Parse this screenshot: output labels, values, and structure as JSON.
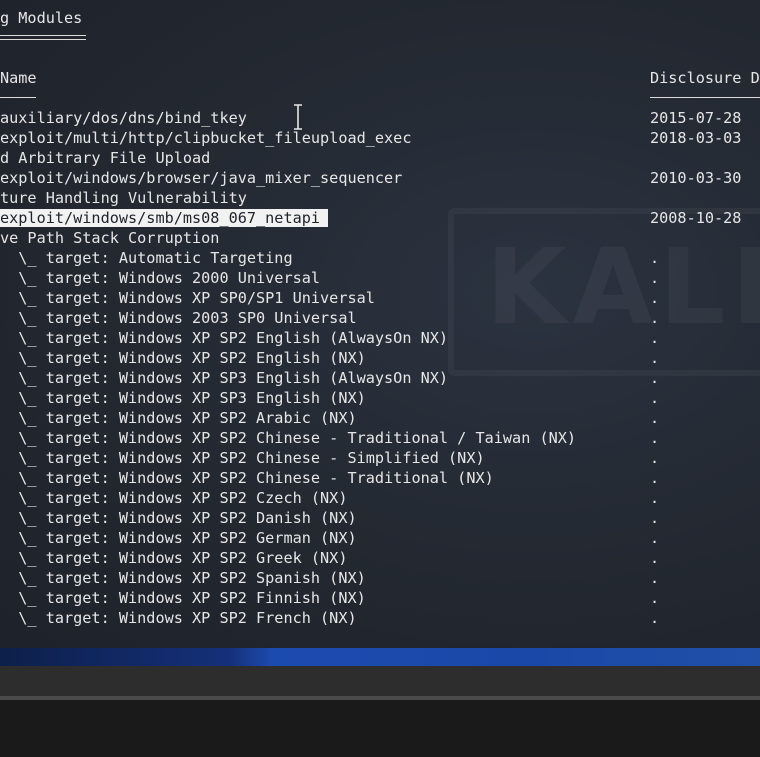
{
  "section_title": "g Modules",
  "headers": {
    "name": "Name",
    "disclosure": "Disclosure D"
  },
  "rows": [
    {
      "name": "auxiliary/dos/dns/bind_tkey",
      "date": "2015-07-28"
    },
    {
      "name": "exploit/multi/http/clipbucket_fileupload_exec",
      "date": "2018-03-03"
    },
    {
      "name": "d Arbitrary File Upload",
      "date": ""
    },
    {
      "name": "exploit/windows/browser/java_mixer_sequencer",
      "date": "2010-03-30"
    },
    {
      "name": "ture Handling Vulnerability",
      "date": ""
    },
    {
      "name": "exploit/windows/smb/ms08_067_netapi",
      "date": "2008-10-28"
    },
    {
      "name": "ve Path Stack Corruption",
      "date": ""
    },
    {
      "name": "  \\_ target: Automatic Targeting",
      "date": "."
    },
    {
      "name": "  \\_ target: Windows 2000 Universal",
      "date": "."
    },
    {
      "name": "  \\_ target: Windows XP SP0/SP1 Universal",
      "date": "."
    },
    {
      "name": "  \\_ target: Windows 2003 SP0 Universal",
      "date": "."
    },
    {
      "name": "  \\_ target: Windows XP SP2 English (AlwaysOn NX)",
      "date": "."
    },
    {
      "name": "  \\_ target: Windows XP SP2 English (NX)",
      "date": "."
    },
    {
      "name": "  \\_ target: Windows XP SP3 English (AlwaysOn NX)",
      "date": "."
    },
    {
      "name": "  \\_ target: Windows XP SP3 English (NX)",
      "date": "."
    },
    {
      "name": "  \\_ target: Windows XP SP2 Arabic (NX)",
      "date": "."
    },
    {
      "name": "  \\_ target: Windows XP SP2 Chinese - Traditional / Taiwan (NX)",
      "date": "."
    },
    {
      "name": "  \\_ target: Windows XP SP2 Chinese - Simplified (NX)",
      "date": "."
    },
    {
      "name": "  \\_ target: Windows XP SP2 Chinese - Traditional (NX)",
      "date": "."
    },
    {
      "name": "  \\_ target: Windows XP SP2 Czech (NX)",
      "date": "."
    },
    {
      "name": "  \\_ target: Windows XP SP2 Danish (NX)",
      "date": "."
    },
    {
      "name": "  \\_ target: Windows XP SP2 German (NX)",
      "date": "."
    },
    {
      "name": "  \\_ target: Windows XP SP2 Greek (NX)",
      "date": "."
    },
    {
      "name": "  \\_ target: Windows XP SP2 Spanish (NX)",
      "date": "."
    },
    {
      "name": "  \\_ target: Windows XP SP2 Finnish (NX)",
      "date": "."
    },
    {
      "name": "  \\_ target: Windows XP SP2 French (NX)",
      "date": "."
    }
  ],
  "highlighted_row": 5,
  "watermark": "KALI",
  "colors": {
    "terminal_bg": "#232831",
    "text": "#e6e6e6",
    "highlight_bg": "#f2f2f2",
    "taskbar": "#2d2d2d"
  }
}
